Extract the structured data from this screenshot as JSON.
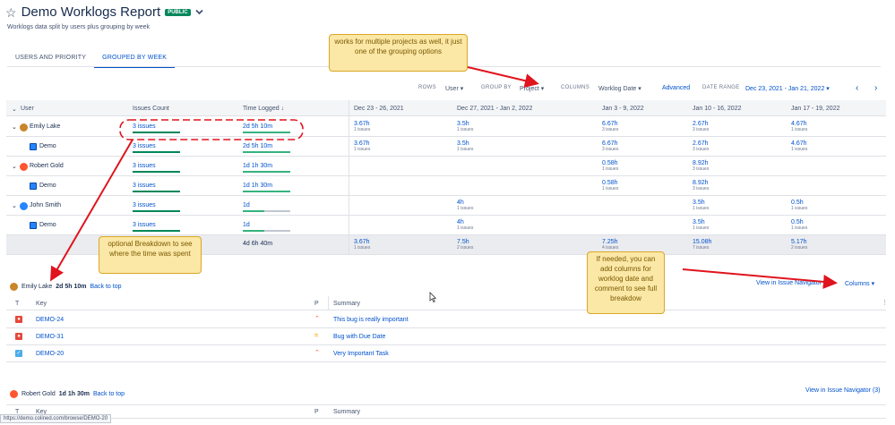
{
  "header": {
    "title": "Demo Worklogs Report",
    "badge": "PUBLIC",
    "subtitle": "Worklogs data split by users plus grouping by week"
  },
  "tabs": [
    {
      "label": "USERS AND PRIORITY",
      "active": false
    },
    {
      "label": "GROUPED BY WEEK",
      "active": true
    }
  ],
  "toolbar": {
    "rows_label": "ROWS",
    "rows_value": "User",
    "group_label": "GROUP BY",
    "group_value": "Project",
    "columns_label": "COLUMNS",
    "columns_value": "Worklog Date",
    "advanced": "Advanced",
    "range_label": "DATE RANGE",
    "range_value": "Dec 23, 2021 - Jan 21, 2022"
  },
  "table": {
    "headers": {
      "user": "User",
      "issues": "Issues Count",
      "time": "Time Logged"
    },
    "weeks": [
      "Dec 23 - 26, 2021",
      "Dec 27, 2021 - Jan 2, 2022",
      "Jan 3 - 9, 2022",
      "Jan 10 - 16, 2022",
      "Jan 17 - 19, 2022"
    ],
    "rows": [
      {
        "label": "Emily Lake",
        "issues": "3 issues",
        "time": "2d 5h 10m",
        "time_frac": 1.0,
        "cells": [
          [
            "3.67h",
            "1 issues"
          ],
          [
            "3.5h",
            "1 issues"
          ],
          [
            "6.67h",
            "3 issues"
          ],
          [
            "2.67h",
            "3 issues"
          ],
          [
            "4.67h",
            "1 issues"
          ]
        ]
      },
      {
        "label": "Demo",
        "issues": "3 issues",
        "time": "2d 5h 10m",
        "time_frac": 1.0,
        "cells": [
          [
            "3.67h",
            "1 issues"
          ],
          [
            "3.5h",
            "1 issues"
          ],
          [
            "6.67h",
            "3 issues"
          ],
          [
            "2.67h",
            "3 issues"
          ],
          [
            "4.67h",
            "1 issues"
          ]
        ]
      },
      {
        "label": "Robert Gold",
        "issues": "3 issues",
        "time": "1d 1h 30m",
        "time_frac": 1.0,
        "cells": [
          [
            "",
            ""
          ],
          [
            "",
            ""
          ],
          [
            "0.58h",
            "1 issues"
          ],
          [
            "8.92h",
            "3 issues"
          ],
          [
            "",
            ""
          ]
        ]
      },
      {
        "label": "Demo",
        "issues": "3 issues",
        "time": "1d 1h 30m",
        "time_frac": 1.0,
        "cells": [
          [
            "",
            ""
          ],
          [
            "",
            ""
          ],
          [
            "0.58h",
            "1 issues"
          ],
          [
            "8.92h",
            "3 issues"
          ],
          [
            "",
            ""
          ]
        ]
      },
      {
        "label": "John Smith",
        "issues": "3 issues",
        "time": "1d",
        "time_frac": 0.45,
        "cells": [
          [
            "",
            ""
          ],
          [
            "4h",
            "1 issues"
          ],
          [
            "",
            ""
          ],
          [
            "3.5h",
            "1 issues"
          ],
          [
            "0.5h",
            "1 issues"
          ]
        ]
      },
      {
        "label": "Demo",
        "issues": "3 issues",
        "time": "1d",
        "time_frac": 0.45,
        "cells": [
          [
            "",
            ""
          ],
          [
            "4h",
            "1 issues"
          ],
          [
            "",
            ""
          ],
          [
            "3.5h",
            "1 issues"
          ],
          [
            "0.5h",
            "1 issues"
          ]
        ]
      }
    ],
    "total": {
      "time": "4d 6h 40m",
      "cells": [
        [
          "3.67h",
          "1 issues"
        ],
        [
          "7.5h",
          "2 issues"
        ],
        [
          "7.25h",
          "4 issues"
        ],
        [
          "15.08h",
          "7 issues"
        ],
        [
          "5.17h",
          "2 issues"
        ]
      ]
    }
  },
  "detail1": {
    "user": "Emily Lake",
    "time": "2d 5h 10m",
    "back": "Back to top",
    "navigator": "View in Issue Navigator (3)",
    "columns": "Columns",
    "headers": {
      "t": "T",
      "key": "Key",
      "p": "P",
      "summary": "Summary"
    },
    "issues": [
      {
        "key": "DEMO-24",
        "summary": "This bug is really important",
        "type": "bug",
        "priority": "high"
      },
      {
        "key": "DEMO-31",
        "summary": "Bug with Due Date",
        "type": "bug",
        "priority": "medium"
      },
      {
        "key": "DEMO-20",
        "summary": "Very Important Task",
        "type": "task",
        "priority": "high"
      }
    ]
  },
  "detail2": {
    "user": "Robert Gold",
    "time": "1d 1h 30m",
    "back": "Back to top",
    "navigator": "View in Issue Navigator (3)",
    "headers": {
      "t": "T",
      "key": "Key",
      "p": "P",
      "summary": "Summary"
    }
  },
  "notes": {
    "projects": "works for multiple projects as well, it just one of the grouping options",
    "breakdown": "optional Breakdown to see where the time was spent",
    "columns": "If needed, you can add columns for worklog date and comment to see full breakdow"
  },
  "status_url": "https://demo.colined.com/browse/DEMO-20",
  "colors": {
    "accent": "#0052cc",
    "green": "#00875a",
    "annotation": "#e0141e",
    "note_bg": "#fbe7a6"
  }
}
